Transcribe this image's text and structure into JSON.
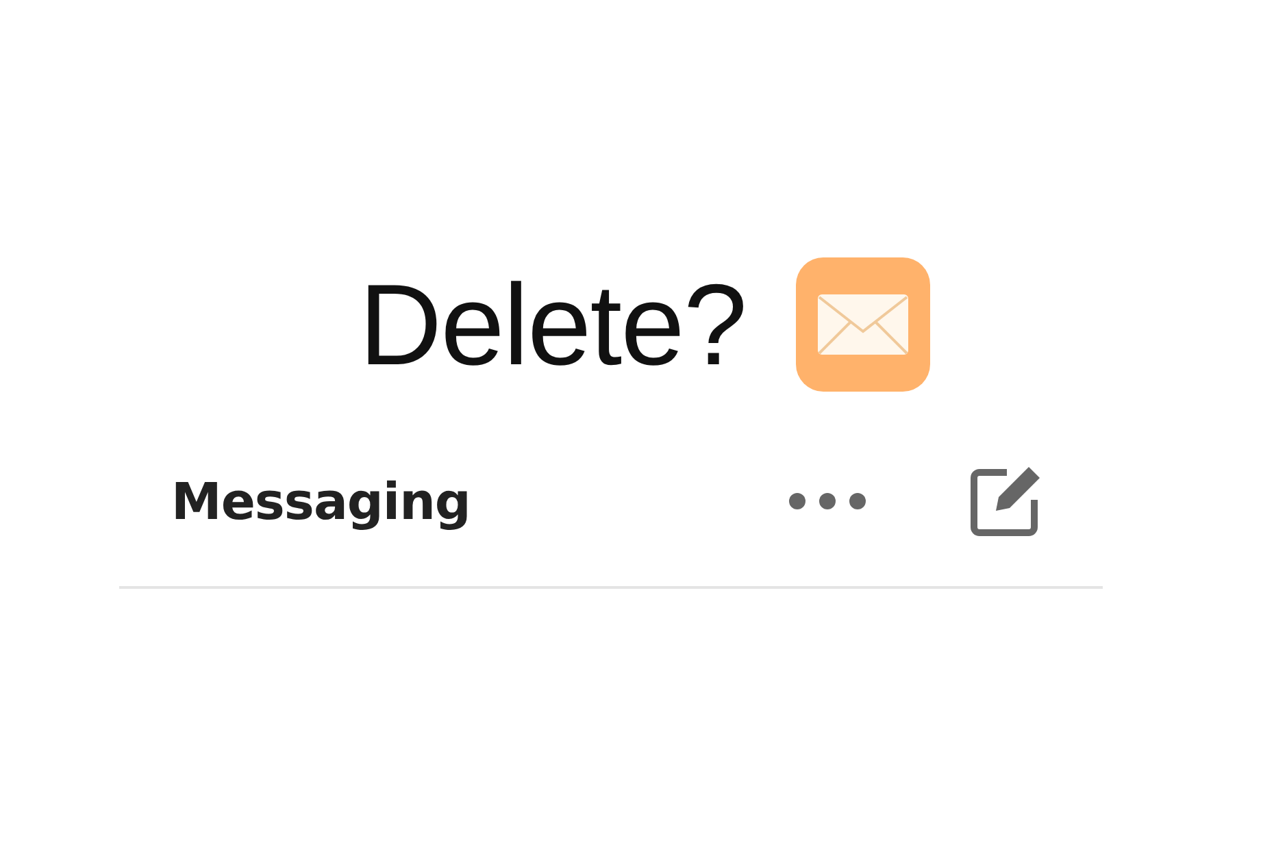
{
  "headline": "Delete?",
  "header": {
    "title": "Messaging"
  }
}
